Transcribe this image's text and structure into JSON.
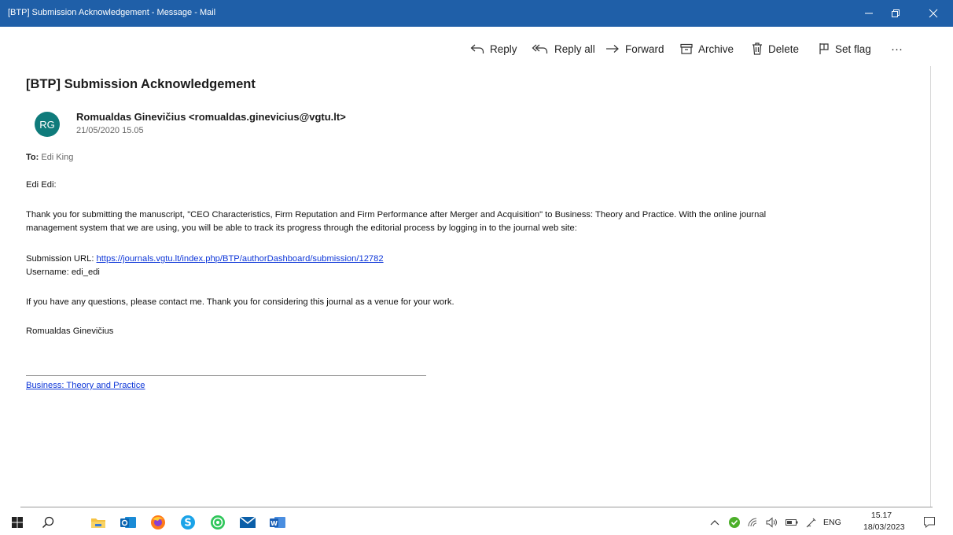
{
  "window": {
    "title": "[BTP] Submission Acknowledgement - Message - Mail"
  },
  "toolbar": {
    "reply": "Reply",
    "reply_all": "Reply all",
    "forward": "Forward",
    "archive": "Archive",
    "delete": "Delete",
    "set_flag": "Set flag",
    "more": "···"
  },
  "message": {
    "subject": "[BTP] Submission Acknowledgement",
    "avatar_initials": "RG",
    "sender": "Romualdas Ginevičius <romualdas.ginevicius@vgtu.lt>",
    "date": "21/05/2020 15.05",
    "to_label": "To:",
    "to_value": " Edi King",
    "greeting": "Edi Edi:",
    "paragraph_line1": "Thank you for submitting the manuscript, \"CEO Characteristics, Firm Reputation and Firm Performance after Merger and Acquisition\" to Business: Theory and Practice. With the online journal",
    "paragraph_line2": "management system that we are using, you will be able to track its progress through the editorial process by logging in to the journal web site:",
    "submission_url_label": "Submission URL: ",
    "submission_url": "https://journals.vgtu.lt/index.php/BTP/authorDashboard/submission/12782",
    "username_line": "Username: edi_edi",
    "questions_line": "If you have any questions, please contact me. Thank you for considering this journal as a venue for your work.",
    "signature": "Romualdas Ginevičius",
    "footer_link": "Business: Theory and Practice"
  },
  "taskbar": {
    "apps": [
      "windows-start",
      "search",
      "file-explorer",
      "outlook",
      "firefox",
      "skype",
      "whatsapp",
      "mail",
      "word"
    ],
    "language": "ENG",
    "time": "15.17",
    "date": "18/03/2023"
  },
  "colors": {
    "titlebar": "#1f5fa8",
    "avatar": "#0f7b7b",
    "link": "#0d36d8"
  }
}
